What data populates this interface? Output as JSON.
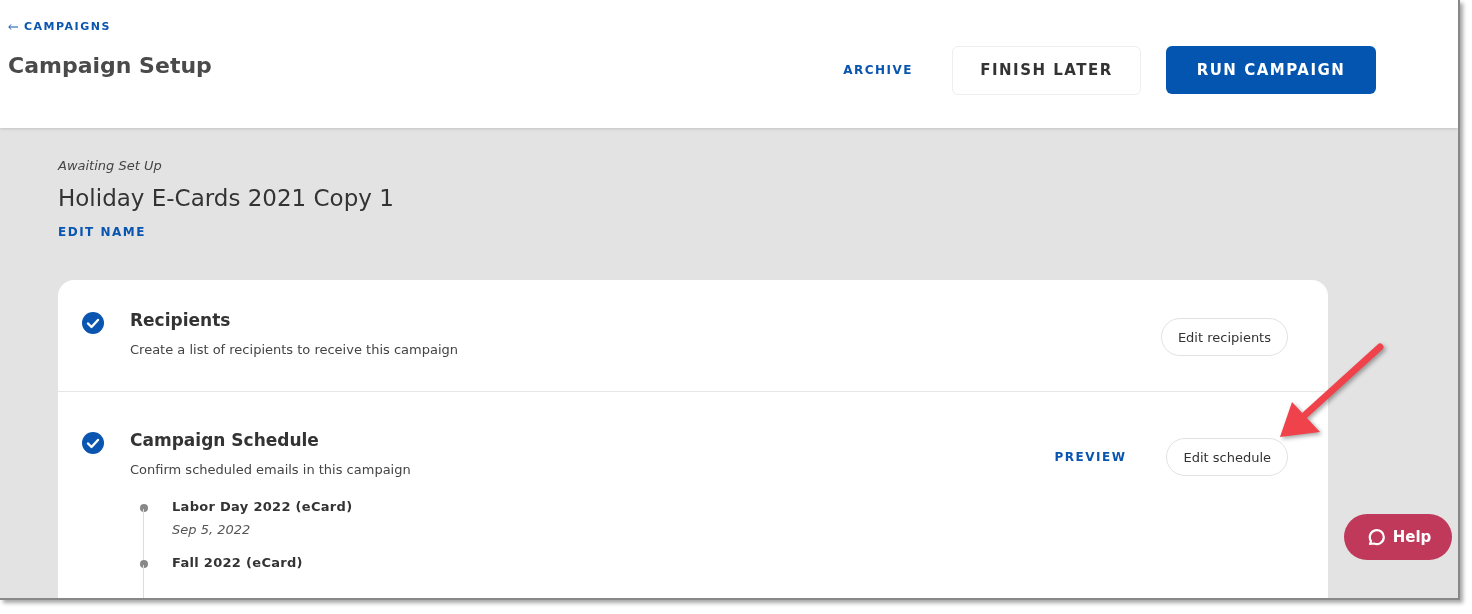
{
  "header": {
    "back_link": "CAMPAIGNS",
    "title": "Campaign Setup",
    "actions": [
      {
        "label": "ARCHIVE",
        "kind": "link"
      },
      {
        "label": "FINISH LATER",
        "kind": "secondary"
      },
      {
        "label": "RUN CAMPAIGN",
        "kind": "primary"
      }
    ]
  },
  "campaign": {
    "status": "Awaiting Set Up",
    "name": "Holiday E-Cards 2021 Copy 1",
    "edit_link": "EDIT NAME"
  },
  "steps": [
    {
      "title": "Recipients",
      "description": "Create a list of recipients to receive this campaign",
      "completed": true,
      "edit_button": "Edit recipients"
    },
    {
      "title": "Campaign Schedule",
      "description": "Confirm scheduled emails in this campaign",
      "completed": true,
      "preview_link": "PREVIEW",
      "edit_button": "Edit schedule",
      "emails": [
        {
          "name": "Labor Day 2022 (eCard)",
          "date": "Sep 5, 2022"
        },
        {
          "name": "Fall 2022 (eCard)"
        }
      ]
    }
  ],
  "help_button": "Help"
}
